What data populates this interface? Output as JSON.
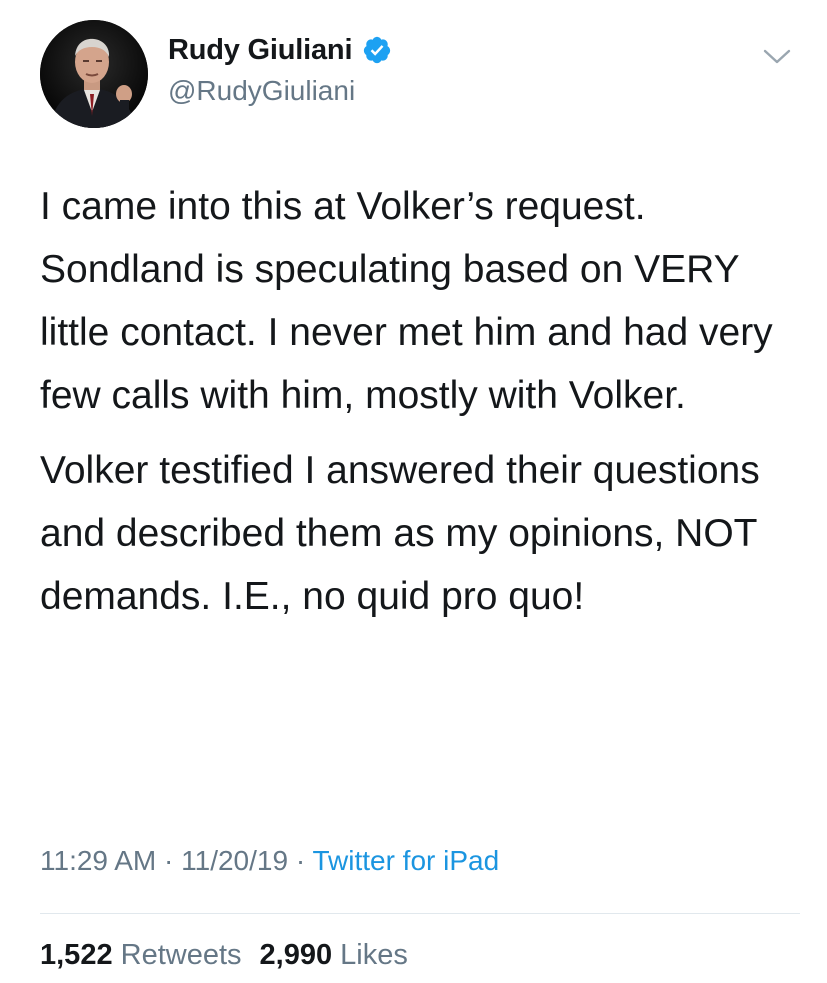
{
  "author": {
    "display_name": "Rudy Giuliani",
    "handle": "@RudyGiuliani",
    "verified": true,
    "verified_icon": "verified-badge-icon",
    "avatar": "profile-photo"
  },
  "menu": {
    "icon": "chevron-down-icon"
  },
  "tweet": {
    "paragraphs": [
      "I came into this at Volker’s request. Sondland is speculating based on VERY little contact. I never met him and had very few calls with him, mostly with Volker.",
      "Volker testified I answered their questions and described them as my opinions, NOT demands. I.E., no quid pro quo!"
    ]
  },
  "meta": {
    "time": "11:29 AM",
    "separator": " · ",
    "date": "11/20/19",
    "source": "Twitter for iPad"
  },
  "stats": {
    "retweets_count": "1,522",
    "retweets_label": "Retweets",
    "likes_count": "2,990",
    "likes_label": "Likes"
  },
  "colors": {
    "text": "#14171a",
    "secondary": "#657786",
    "link": "#1b95e0",
    "verified": "#1da1f2",
    "divider": "#e1e8ed"
  }
}
